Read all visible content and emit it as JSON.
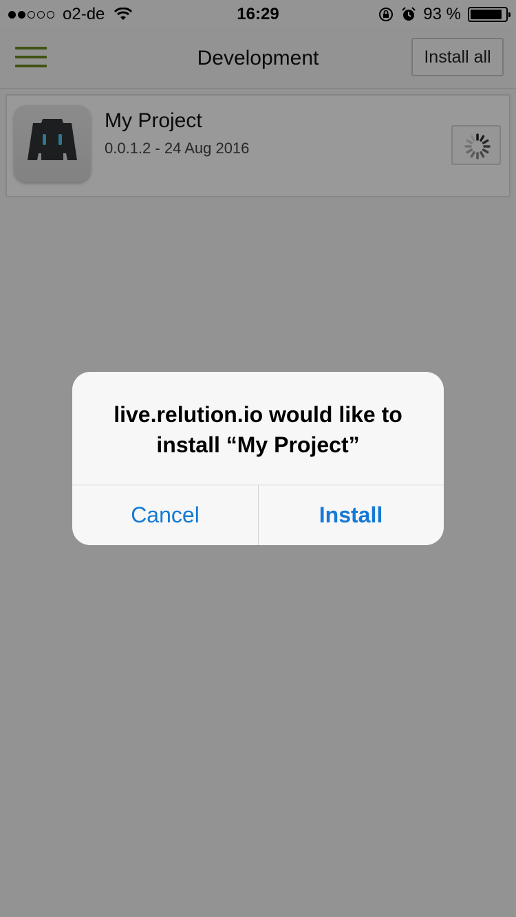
{
  "status_bar": {
    "signal": "●●○○○",
    "carrier": "o2-de",
    "time": "16:29",
    "battery_text": "93 %",
    "icons": [
      "wifi-icon",
      "rotation-lock-icon",
      "alarm-icon",
      "battery-icon"
    ]
  },
  "navbar": {
    "title": "Development",
    "install_all_label": "Install all",
    "menu_icon": "hamburger-menu-icon",
    "accent_color": "#6b8a1f"
  },
  "apps": [
    {
      "name": "My Project",
      "meta": "0.0.1.2 - 24 Aug 2016",
      "icon": "cordova-app-icon",
      "status": "installing-spinner"
    }
  ],
  "alert": {
    "message_line1": "live.relution.io would like to",
    "message_line2": "install “My Project”",
    "cancel_label": "Cancel",
    "install_label": "Install",
    "button_color": "#1479d6"
  }
}
